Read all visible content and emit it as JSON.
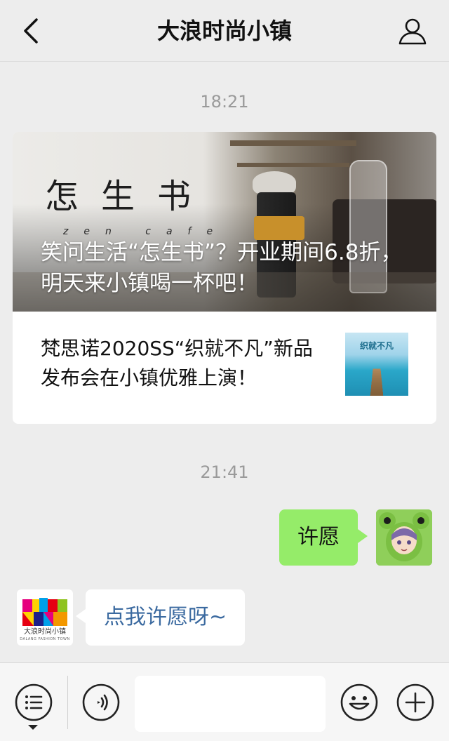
{
  "header": {
    "title": "大浪时尚小镇",
    "back_icon": "chevron-left-icon",
    "profile_icon": "person-icon"
  },
  "messages": [
    {
      "type": "timestamp",
      "text": "18:21"
    },
    {
      "type": "article_card",
      "cover": {
        "logo_text": "怎生书",
        "logo_subtext": "zen cafe",
        "title": "笑问生活“怎生书”？开业期间6.8折，明天来小镇喝一杯吧！"
      },
      "sub_article": {
        "title": "梵思诺2020SS“织就不凡”新品发布会在小镇优雅上演！",
        "thumbnail_text": "织就不凡"
      }
    },
    {
      "type": "timestamp",
      "text": "21:41"
    },
    {
      "type": "outgoing",
      "text": "许愿"
    },
    {
      "type": "incoming",
      "text": "点我许愿呀~"
    }
  ],
  "brand_avatar": {
    "name": "大浪时尚小镇",
    "name_en": "DALANG FASHION TOWN"
  },
  "input_bar": {
    "menu_icon": "menu-list-icon",
    "voice_icon": "voice-icon",
    "emoji_icon": "emoji-icon",
    "plus_icon": "plus-icon",
    "input_value": ""
  },
  "colors": {
    "background": "#ededed",
    "outgoing_bubble": "#95ec69",
    "incoming_text": "#3b6aa0",
    "timestamp": "#9a9a9a"
  }
}
